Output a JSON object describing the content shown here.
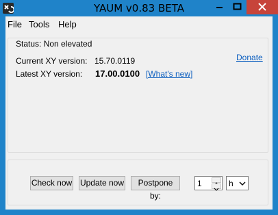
{
  "window": {
    "title": "YAUM v0.83 BETA",
    "accent_color": "#1f83c9",
    "close_color": "#c7443a"
  },
  "menu": {
    "items": [
      "File",
      "Tools",
      "Help"
    ]
  },
  "status": {
    "text": "Status: Non elevated"
  },
  "versions": {
    "current_label": "Current XY version:",
    "current_value": "15.70.0119",
    "latest_label": "Latest XY version:",
    "latest_value": "17.00.0100",
    "whats_new": "[What's new]",
    "donate": "Donate"
  },
  "actions": {
    "check_now": "Check now",
    "update_now": "Update now",
    "postpone": "Postpone by:",
    "postpone_amount": "1",
    "postpone_unit": "h"
  },
  "icons": {
    "app": "yaum-app-icon",
    "minimize": "minimize-icon",
    "maximize": "maximize-icon",
    "close": "close-icon"
  }
}
